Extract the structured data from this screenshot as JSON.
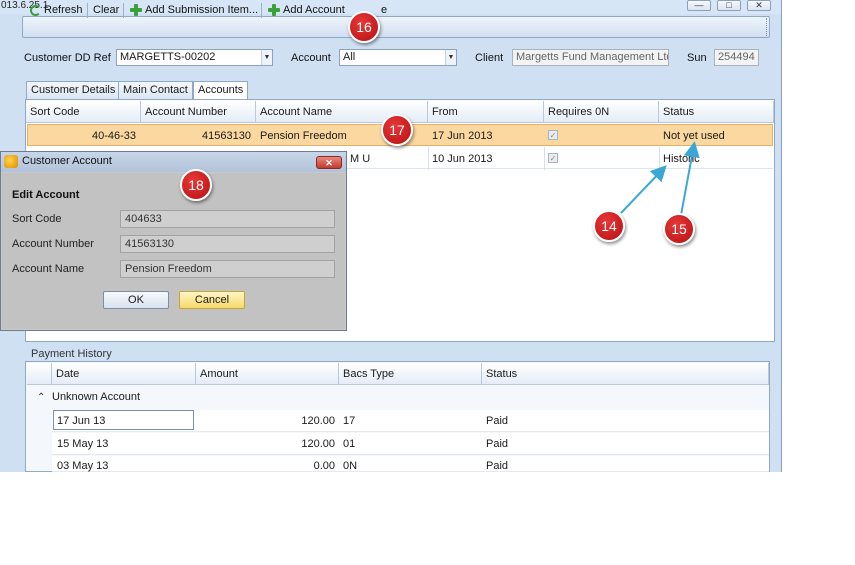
{
  "window": {
    "title": "013.6.25.1",
    "buttons": {
      "minimize": "—",
      "restore": "□",
      "close": "✕"
    }
  },
  "toolbar": {
    "refresh": "Refresh",
    "clear": "Clear",
    "add_submission": "Add Submission Item...",
    "add_account": "Add Account",
    "trailing": "e"
  },
  "filters": {
    "customer_dd_ref_label": "Customer DD Ref",
    "customer_dd_ref_value": "MARGETTS-00202",
    "account_label": "Account",
    "account_value": "All",
    "client_label": "Client",
    "client_value": "Margetts Fund Management Ltd",
    "sun_label": "Sun",
    "sun_value": "254494"
  },
  "tabs": [
    "Customer Details",
    "Main Contact",
    "Accounts"
  ],
  "accounts_grid": {
    "columns": [
      "Sort Code",
      "Account Number",
      "Account Name",
      "From",
      "Requires 0N",
      "Status"
    ],
    "rows": [
      {
        "sort_code": "40-46-33",
        "account_number": "41563130",
        "account_name": "Pension Freedom",
        "from": "17 Jun 2013",
        "requires": "✓",
        "status": "Not yet used"
      },
      {
        "sort_code": "",
        "account_number": "",
        "account_name": "M  U",
        "from": "10 Jun 2013",
        "requires": "✓",
        "status": "Historic"
      }
    ]
  },
  "payment_history": {
    "label": "Payment History",
    "columns": [
      "Date",
      "Amount",
      "Bacs Type",
      "Status"
    ],
    "group": "Unknown Account",
    "rows": [
      {
        "date": "17 Jun 13",
        "amount": "120.00",
        "bacs_type": "17",
        "status": "Paid"
      },
      {
        "date": "15 May 13",
        "amount": "120.00",
        "bacs_type": "01",
        "status": "Paid"
      },
      {
        "date": "03 May 13",
        "amount": "0.00",
        "bacs_type": "0N",
        "status": "Paid"
      }
    ]
  },
  "dialog": {
    "title": "Customer Account",
    "heading": "Edit Account",
    "sort_code_label": "Sort Code",
    "sort_code_value": "404633",
    "account_number_label": "Account Number",
    "account_number_value": "41563130",
    "account_name_label": "Account Name",
    "account_name_value": "Pension Freedom",
    "ok": "OK",
    "cancel": "Cancel",
    "close": "✕"
  },
  "callouts": [
    "14",
    "15",
    "16",
    "17",
    "18"
  ],
  "colors": {
    "callout": "#c8161a",
    "selected_row": "#fbd8a0",
    "chrome": "#cfe0f3"
  }
}
